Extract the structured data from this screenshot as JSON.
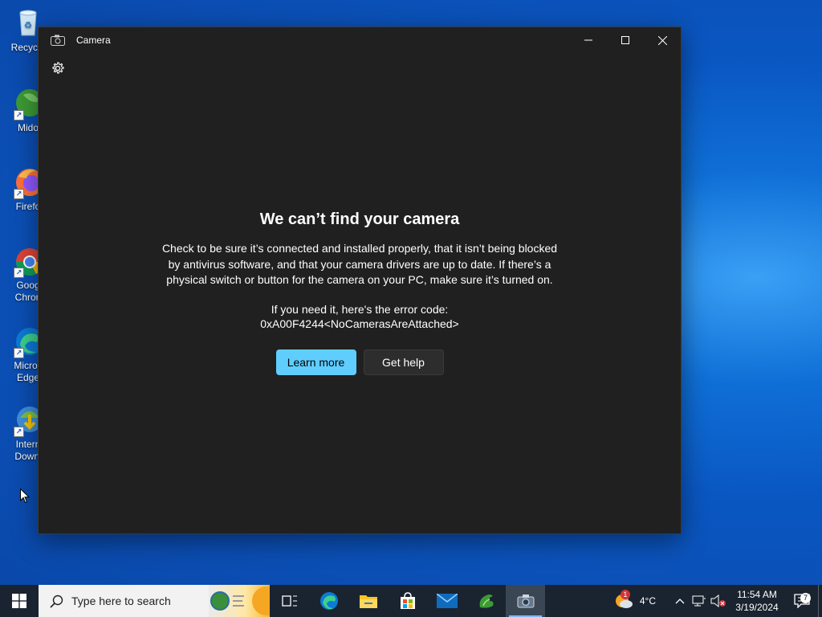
{
  "desktop": {
    "icons": [
      {
        "label": "Recycle",
        "icon": "recycle-bin-icon"
      },
      {
        "label": "Mido",
        "icon": "mido-app-icon"
      },
      {
        "label": "Firefo",
        "icon": "firefox-icon"
      },
      {
        "label": "Goog\nChron",
        "icon": "chrome-icon"
      },
      {
        "label": "Micros\nEdge",
        "icon": "edge-icon"
      },
      {
        "label": "Intern\nDownl",
        "icon": "internet-download-manager-icon"
      }
    ]
  },
  "window": {
    "title": "Camera",
    "controls": {
      "minimize": "—",
      "maximize": "☐",
      "close": "✕"
    },
    "settings_icon": "gear-icon"
  },
  "error": {
    "heading": "We can’t find your camera",
    "body": "Check to be sure it’s connected and installed properly, that it isn’t being blocked by antivirus software, and that your camera drivers are up to date. If there’s a physical switch or button for the camera on your PC, make sure it’s turned on.",
    "code_label": "If you need it, here's the error code:",
    "code": "0xA00F4244<NoCamerasAreAttached>",
    "primary_button": "Learn more",
    "secondary_button": "Get help"
  },
  "taskbar": {
    "search_placeholder": "Type here to search",
    "apps": [
      "task-view-icon",
      "edge-icon",
      "file-explorer-icon",
      "microsoft-store-icon",
      "mail-icon",
      "app-icon",
      "camera-icon"
    ],
    "weather_temp": "4°C",
    "weather_badge": "1",
    "time": "11:54 AM",
    "date": "3/19/2024",
    "notification_count": "7"
  },
  "colors": {
    "accent": "#60cdff",
    "window_bg": "#202020",
    "taskbar_bg": "#1a2430"
  }
}
